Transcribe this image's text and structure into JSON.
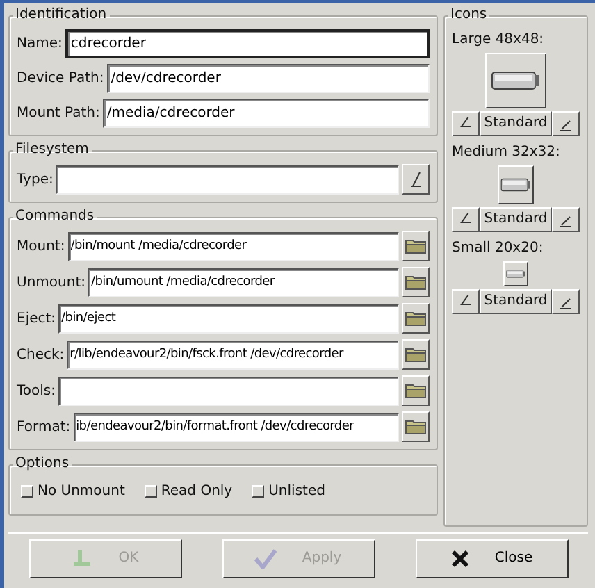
{
  "identification": {
    "title": "Identification",
    "fields": [
      {
        "label": "Name:",
        "value": "cdrecorder",
        "focused": true
      },
      {
        "label": "Device Path:",
        "value": "/dev/cdrecorder",
        "focused": false
      },
      {
        "label": "Mount Path:",
        "value": "/media/cdrecorder",
        "focused": false
      }
    ]
  },
  "filesystem": {
    "title": "Filesystem",
    "label": "Type:"
  },
  "commands": {
    "title": "Commands",
    "fields": [
      {
        "label": "Mount:",
        "value": "/bin/mount /media/cdrecorder"
      },
      {
        "label": "Unmount:",
        "value": "/bin/umount /media/cdrecorder"
      },
      {
        "label": "Eject:",
        "value": "/bin/eject"
      },
      {
        "label": "Check:",
        "value": "r/lib/endeavour2/bin/fsck.front /dev/cdrecorder"
      },
      {
        "label": "Tools:"
      },
      {
        "label": "Format:",
        "value": "ib/endeavour2/bin/format.front /dev/cdrecorder"
      }
    ]
  },
  "options": {
    "title": "Options",
    "items": [
      {
        "label": "No Unmount",
        "checked": false
      },
      {
        "label": "Read Only",
        "checked": false
      },
      {
        "label": "Unlisted",
        "checked": false
      }
    ]
  },
  "icons": {
    "title": "Icons",
    "sets": [
      {
        "label": "Large 48x48:",
        "kind": "large",
        "style": "Standard"
      },
      {
        "label": "Medium 32x32:",
        "kind": "medium",
        "style": "Standard"
      },
      {
        "label": "Small 20x20:",
        "kind": "small",
        "style": "Standard"
      }
    ]
  },
  "buttons": [
    {
      "label": "OK",
      "kind": "ok",
      "disabled": true
    },
    {
      "label": "Apply",
      "kind": "apply",
      "disabled": true
    },
    {
      "label": "Close",
      "kind": "close",
      "disabled": false
    }
  ]
}
